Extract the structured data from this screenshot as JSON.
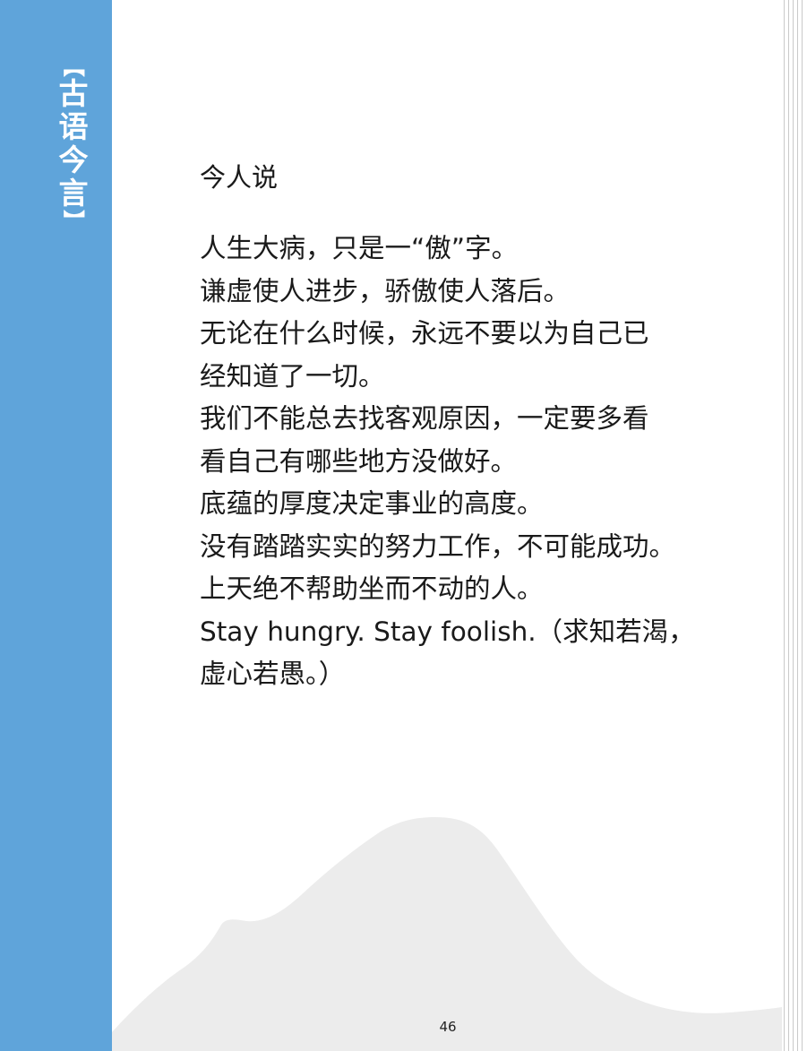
{
  "section_tab": {
    "open_bracket": "【",
    "chars": [
      "古",
      "语",
      "今",
      "言"
    ],
    "close_bracket": "】"
  },
  "heading": "今人说",
  "lines": [
    "人生大病，只是一“傲”字。",
    "谦虚使人进步，骄傲使人落后。",
    "无论在什么时候，永远不要以为自己已",
    "经知道了一切。",
    "我们不能总去找客观原因，一定要多看",
    "看自己有哪些地方没做好。",
    "底蕴的厚度决定事业的高度。",
    "没有踏踏实实的努力工作，不可能成功。",
    "上天绝不帮助坐而不动的人。",
    "Stay hungry. Stay foolish.（求知若渴，",
    "虚心若愚。）"
  ],
  "page_number": "46",
  "colors": {
    "sidebar": "#5fa4da",
    "mountain": "#ececec",
    "text": "#1a1a1a"
  }
}
